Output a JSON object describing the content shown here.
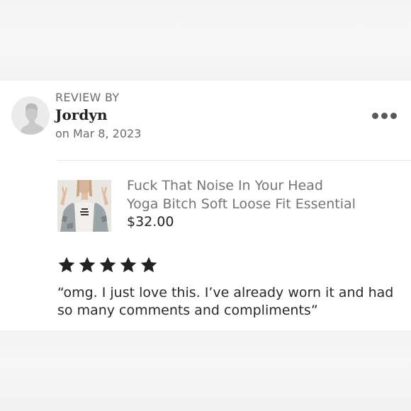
{
  "review": {
    "header_label": "REVIEW BY",
    "reviewer_name": "Jordyn",
    "date": "on Mar 8, 2023",
    "rating": 5,
    "max_rating": 5,
    "text": "“omg. I just love this. I’ve already worn it and had so many comments and compliments”"
  },
  "product": {
    "title_line1": "Fuck That Noise In Your Head",
    "title_line2": "Yoga Bitch Soft Loose Fit Essential",
    "price": "$32.00"
  },
  "icons": {
    "more": "more-horizontal-icon",
    "star": "star-icon",
    "avatar": "default-user-avatar"
  },
  "colors": {
    "star": "#222222",
    "muted_text": "#6b6b6b",
    "primary_text": "#222222"
  }
}
